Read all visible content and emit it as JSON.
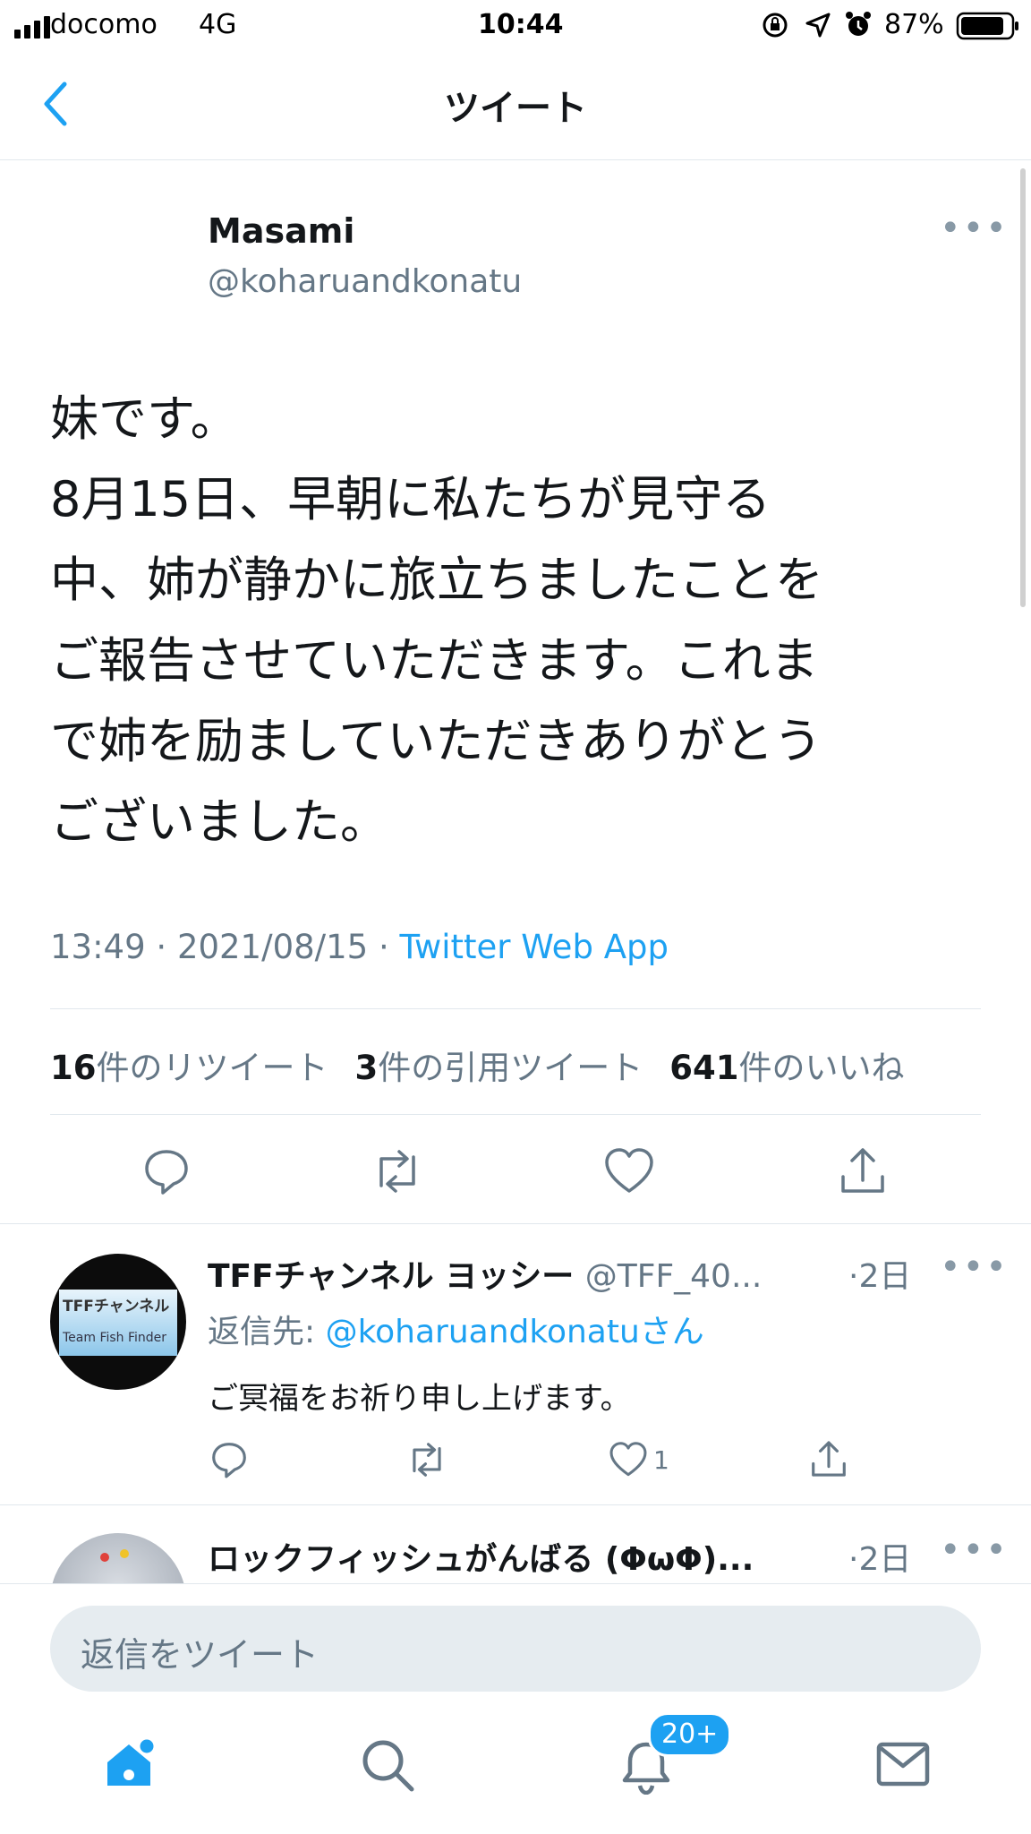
{
  "status_bar": {
    "carrier": "docomo",
    "network": "4G",
    "time": "10:44",
    "battery": "87%",
    "battery_level": 0.87
  },
  "nav": {
    "title": "ツイート"
  },
  "tweet": {
    "author_name": "Masami",
    "author_handle": "@koharuandkonatu",
    "text": "妹です。\n8月15日、早朝に私たちが見守る\n中、姉が静かに旅立ちましたことを\nご報告させていただきます。これま\nで姉を励ましていただきありがとう\nございました。",
    "time": "13:49",
    "date": "2021/08/15",
    "source": "Twitter Web App",
    "stats": {
      "retweets_count": "16",
      "retweets_label": "件のリツイート",
      "quotes_count": "3",
      "quotes_label": "件の引用ツイート",
      "likes_count": "641",
      "likes_label": "件のいいね"
    }
  },
  "replies": [
    {
      "name": "TFFチャンネル ヨッシー",
      "handle": "@TFF_40...",
      "age": "·2日",
      "reply_to_prefix": "返信先: ",
      "reply_to_handle": "@koharuandkonatu",
      "reply_to_suffix": "さん",
      "text": "ご冥福をお祈り申し上げます。",
      "like_count": "1",
      "avatar_lines": [
        "TFFチャンネル",
        "Team Fish Finder"
      ]
    },
    {
      "name": "ロックフィッシュがんばる (ΦωΦ)...",
      "age": "·2日"
    }
  ],
  "reply_box": {
    "placeholder": "返信をツイート"
  },
  "tab_bar": {
    "notification_badge": "20+"
  },
  "colors": {
    "accent": "#1da1f2",
    "text": "#14171a",
    "secondary": "#657786",
    "border": "#e1e8ed"
  }
}
